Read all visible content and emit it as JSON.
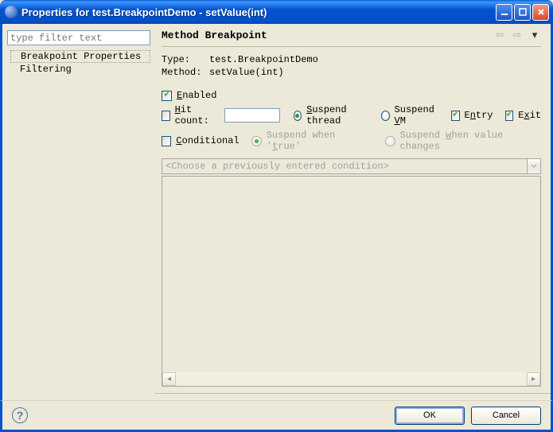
{
  "window": {
    "title": "Properties for test.BreakpointDemo - setValue(int)"
  },
  "sidebar": {
    "filter_placeholder": "type filter text",
    "items": [
      {
        "label": "Breakpoint Properties"
      },
      {
        "label": "Filtering"
      }
    ]
  },
  "header": {
    "title": "Method Breakpoint"
  },
  "info": {
    "type_label": "Type:",
    "type_value": "test.BreakpointDemo",
    "method_label": "Method:",
    "method_value": "setValue(int)"
  },
  "options": {
    "enabled_label": "Enabled",
    "hitcount_label": "Hit count:",
    "suspend_thread_label": "Suspend thread",
    "suspend_vm_label": "Suspend VM",
    "entry_label": "Entry",
    "exit_label": "Exit",
    "conditional_label": "Conditional",
    "suspend_true_label": "Suspend when 'true'",
    "suspend_change_label": "Suspend when value changes",
    "combo_placeholder": "<Choose a previously entered condition>"
  },
  "footer": {
    "ok_label": "OK",
    "cancel_label": "Cancel"
  }
}
